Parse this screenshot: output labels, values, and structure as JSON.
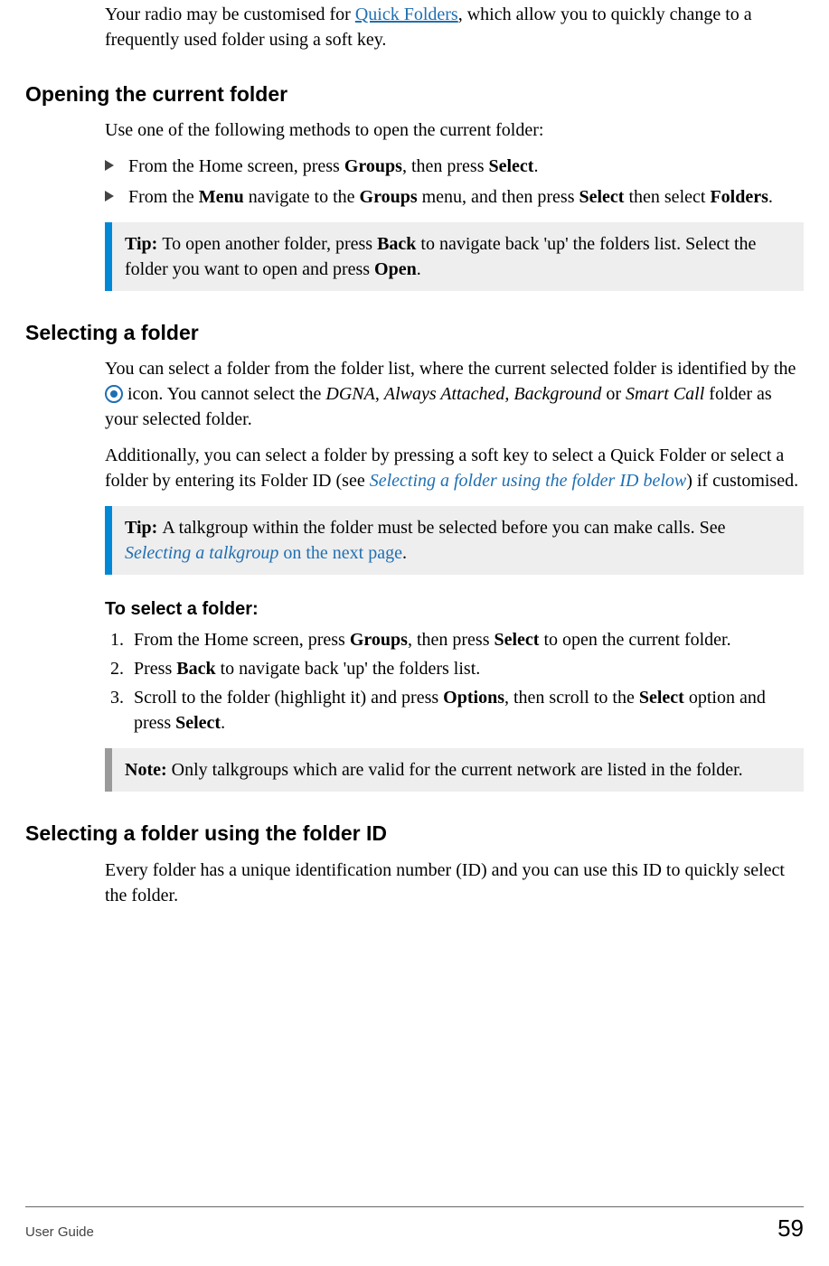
{
  "intro": {
    "prefix": "Your radio may be customised for ",
    "link": "Quick Folders",
    "suffix": ", which allow you to quickly change to a frequently used folder using a soft key."
  },
  "sections": {
    "opening": {
      "title": "Opening the current folder",
      "lead": "Use one of the following methods to open the current folder:",
      "bullets": {
        "b1": {
          "t1": "From the Home screen, press ",
          "bold1": "Groups",
          "t2": ", then press ",
          "bold2": "Select",
          "t3": "."
        },
        "b2": {
          "t1": "From the ",
          "bold1": "Menu",
          "t2": " navigate to the ",
          "bold2": "Groups",
          "t3": " menu, and then press ",
          "bold3": "Select",
          "t4": " then select ",
          "bold4": "Folders",
          "t5": "."
        }
      },
      "tip": {
        "label": "Tip: ",
        "t1": "To open another folder, press ",
        "bold1": "Back",
        "t2": " to navigate back 'up' the folders list. Select the folder you want to open and press ",
        "bold2": "Open",
        "t3": "."
      }
    },
    "selecting": {
      "title": "Selecting a folder",
      "p1": {
        "t1": "You can select a folder from the folder list, where the current selected folder is identified by the ",
        "icon_name": "selected-folder-icon",
        "t2": " icon. You cannot select the ",
        "i1": "DGNA",
        "t3": ", ",
        "i2": "Always Attached",
        "t4": ", ",
        "i3": "Background",
        "t5": " or ",
        "i4": "Smart Call",
        "t6": " folder as your selected folder."
      },
      "p2": {
        "t1": "Additionally, you can select a folder by pressing a soft key to select a Quick Folder or select a folder by entering its Folder ID (see ",
        "link_italic": "Selecting a folder using the folder ID",
        "link_tail": " below",
        "t2": ") if customised."
      },
      "tip": {
        "label": "Tip: ",
        "t1": "A talkgroup within the folder must be selected before you can make calls. See  ",
        "link_italic": "Selecting a talkgroup",
        "link_tail": " on the next page",
        "t2": "."
      },
      "to_select_title": "To select a folder:",
      "steps": {
        "s1": {
          "t1": "From the Home screen, press ",
          "bold1": "Groups",
          "t2": ", then press ",
          "bold2": "Select",
          "t3": " to open the current folder."
        },
        "s2": {
          "t1": "Press ",
          "bold1": "Back",
          "t2": " to navigate back 'up' the folders list."
        },
        "s3": {
          "t1": "Scroll to the folder (highlight it) and press ",
          "bold1": "Options",
          "t2": ", then scroll to the ",
          "bold2": "Select",
          "t3": " option and press ",
          "bold3": "Select",
          "t4": "."
        }
      },
      "note": {
        "label": "Note: ",
        "t1": "Only talkgroups which are valid for the current network are listed in the folder."
      }
    },
    "folder_id": {
      "title": "Selecting a folder using the folder ID",
      "p1": "Every folder has a unique identification number (ID) and you can use this ID to quickly select the folder."
    }
  },
  "footer": {
    "left": "User Guide",
    "page": "59"
  }
}
